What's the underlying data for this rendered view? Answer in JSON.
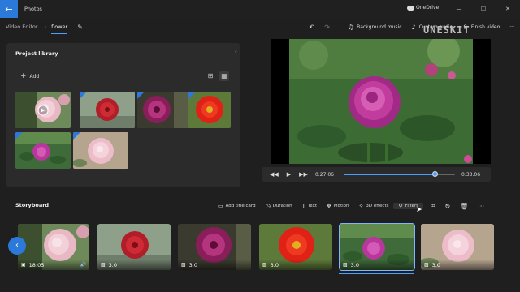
{
  "titlebar": {
    "back_icon": "back-arrow-icon",
    "app_title": "Photos",
    "onedrive_label": "OneDrive",
    "min": "—",
    "max": "☐",
    "close": "✕"
  },
  "cmdbar": {
    "crumb_root": "Video Editor",
    "crumb_sep": "›",
    "project_name": "flower",
    "undo": "↶",
    "redo": "↷",
    "background_music": "Background music",
    "custom_audio": "Custom audio",
    "finish_video": "Finish video",
    "more": "···"
  },
  "library": {
    "title": "Project library",
    "collapse": "‹",
    "add_label": "Add",
    "add_icon": "+"
  },
  "preview": {
    "watermark": "UNESKIT"
  },
  "playback": {
    "rewind": "◀◀",
    "play": "▶",
    "forward": "▶▶",
    "current_time": "0:27.06",
    "total_time": "0:33.06",
    "progress": 0.8186
  },
  "storyboard": {
    "title": "Storyboard",
    "add_title_card": "Add title card",
    "duration": "Duration",
    "text": "Text",
    "motion": "Motion",
    "effects_3d": "3D effects",
    "filters": "Filters",
    "nav_left": "‹",
    "clips": [
      {
        "duration": "18:05",
        "type": "video"
      },
      {
        "duration": "3.0",
        "type": "image"
      },
      {
        "duration": "3.0",
        "type": "image"
      },
      {
        "duration": "3.0",
        "type": "image"
      },
      {
        "duration": "3.0",
        "type": "image"
      },
      {
        "duration": "3.0",
        "type": "image"
      }
    ]
  },
  "colors": {
    "accent": "#2b79d8",
    "progress": "#4aa0ff",
    "background": "#1f1f1f",
    "panel": "#2b2b2b"
  }
}
